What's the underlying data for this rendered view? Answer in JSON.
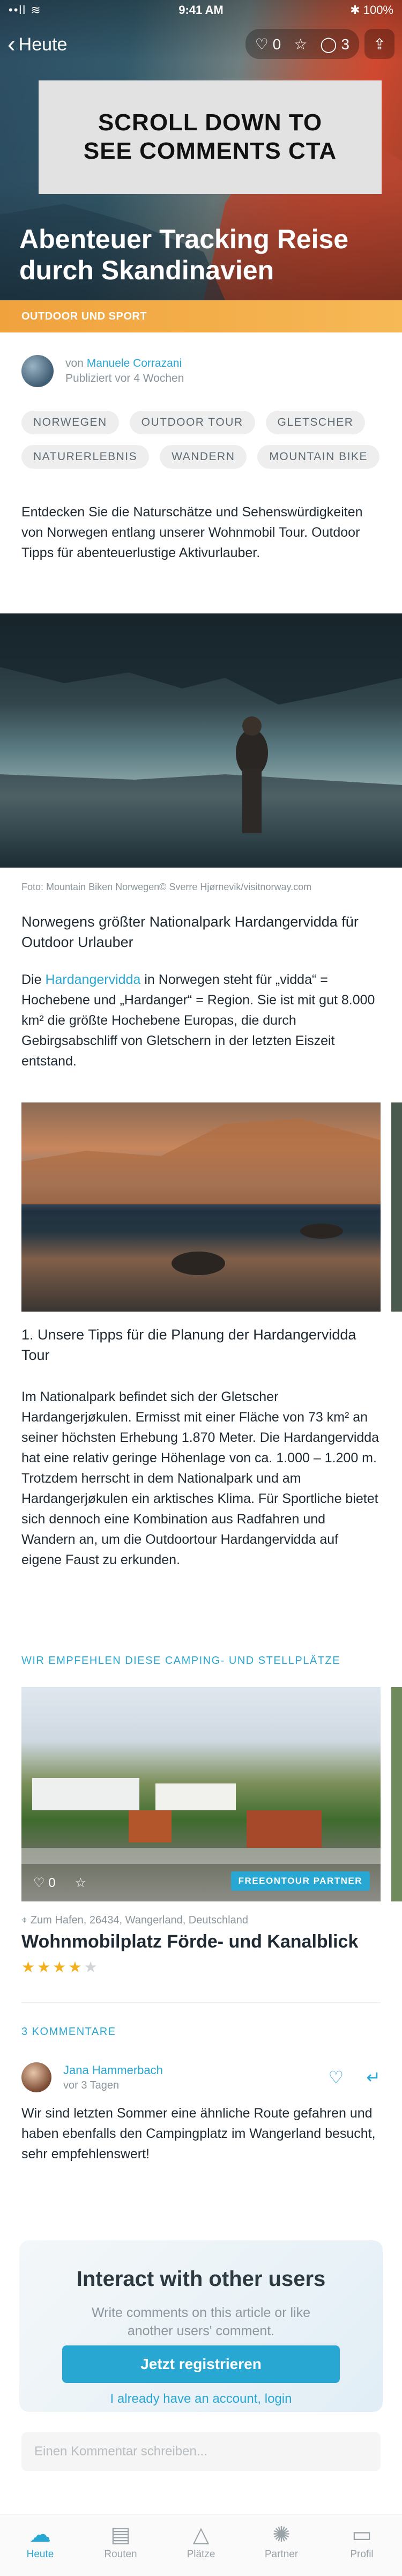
{
  "status_bar": {
    "carrier": "••ll ≋",
    "time": "9:41 AM",
    "battery": "✱ 100%"
  },
  "nav": {
    "back_label": "Heute",
    "likes": "0",
    "comments": "3"
  },
  "hero": {
    "cta_line1": "SCROLL  DOWN TO",
    "cta_line2": "SEE COMMENTS CTA",
    "title": "Abenteuer Tracking Reise durch Skandinavien"
  },
  "category": "OUTDOOR UND SPORT",
  "author": {
    "prefix": "von",
    "name": "Manuele Corrazani",
    "published": "Publiziert vor 4 Wochen"
  },
  "tags": [
    "NORWEGEN",
    "OUTDOOR TOUR",
    "GLETSCHER",
    "NATURERLEBNIS",
    "WANDERN",
    "MOUNTAIN BIKE"
  ],
  "intro": "Entdecken Sie die Naturschätze und Sehenswürdigkeiten von Norwegen entlang unserer Wohnmobil Tour. Outdoor Tipps für abenteuerlustige Aktivurlauber.",
  "photo_caption": "Foto: Mountain Biken Norwegen© Sverre Hjørnevik/visitnorway.com",
  "section1": {
    "heading": "Norwegens größter Nationalpark Hardangervidda für Outdoor Urlauber",
    "p_before": "Die ",
    "p_link": "Hardangervidda",
    "p_after": " in Norwegen steht für „vidda“ = Hochebene und „Hardanger“ = Region. Sie ist mit gut 8.000 km² die größte Hochebene Europas, die durch Gebirgsabschliff von Gletschern in der letzten Eiszeit entstand."
  },
  "section2": {
    "heading": "1. Unsere Tipps für die Planung der Hardangervidda Tour",
    "body": "Im Nationalpark befindet sich der Gletscher Hardangerjøkulen. Ermisst mit einer Fläche von 73 km² an seiner höchsten Erhebung 1.870 Meter. Die Hardangervidda hat eine relativ geringe Höhenlage von ca. 1.000 – 1.200 m. Trotzdem herrscht in dem Nationalpark und am Hardangerjøkulen ein arktisches Klima. Für Sportliche bietet sich dennoch eine Kombination aus Radfahren und Wandern an, um die Outdoortour Hardangervidda auf eigene Faust zu erkunden."
  },
  "camping": {
    "section_label": "WIR EMPFEHLEN DIESE CAMPING- UND STELLPLÄTZE",
    "likes": "0",
    "badge": "FREEONTOUR PARTNER",
    "location": "Zum Hafen, 26434, Wangerland, Deutschland",
    "title": "Wohnmobilplatz Förde- und Kanalblick",
    "rating": 4,
    "rating_max": 5
  },
  "comments": {
    "label": "3 KOMMENTARE",
    "items": [
      {
        "author": "Jana Hammerbach",
        "time": "vor 3 Tagen",
        "text": "Wir sind letzten Sommer eine ähnliche Route gefahren und haben ebenfalls den Campingplatz im Wangerland besucht, sehr empfehlenswert!"
      }
    ]
  },
  "interact": {
    "title": "Interact with other users",
    "subtitle": "Write comments on this article or like another users' comment.",
    "register": "Jetzt registrieren",
    "login": "I already have an account, login"
  },
  "comment_input": {
    "placeholder": "Einen Kommentar schreiben..."
  },
  "tabbar": [
    {
      "label": "Heute",
      "icon": "cloud-icon",
      "active": true
    },
    {
      "label": "Routen",
      "icon": "map-icon",
      "active": false
    },
    {
      "label": "Plätze",
      "icon": "tent-icon",
      "active": false
    },
    {
      "label": "Partner",
      "icon": "sun-icon",
      "active": false
    },
    {
      "label": "Profil",
      "icon": "profile-card-icon",
      "active": false
    }
  ],
  "colors": {
    "accent": "#29a7d3",
    "category_orange": "#f0a23d",
    "star": "#f2b01e"
  }
}
